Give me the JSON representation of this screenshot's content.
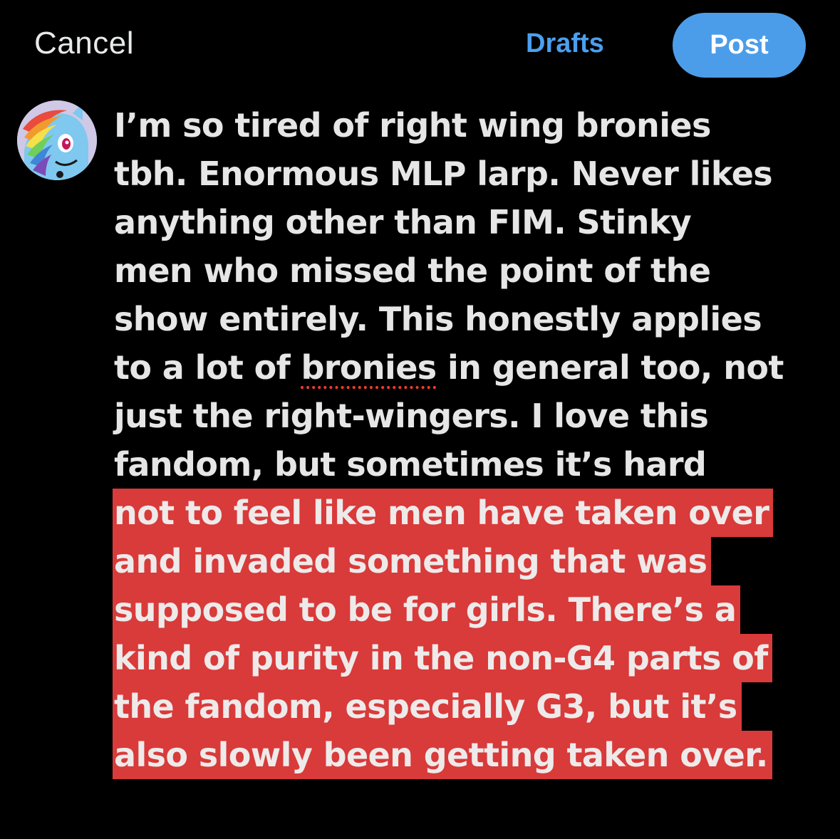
{
  "header": {
    "cancel_label": "Cancel",
    "drafts_label": "Drafts",
    "post_label": "Post"
  },
  "colors": {
    "background": "#000000",
    "accent": "#4c9de9",
    "highlight": "#d93a3a"
  },
  "composer": {
    "avatar_icon": "pony-avatar-icon",
    "lines": [
      "I’m so tired of right wing bronies",
      "tbh. Enormous MLP larp. Never likes",
      "anything other than FIM. Stinky",
      "men who missed the point of the",
      "show entirely. This honestly applies",
      "to a lot of ",
      "bronies",
      " in general too, not",
      "just the right-wingers. I love this",
      "fandom, but sometimes it’s hard"
    ],
    "highlighted_lines": [
      "not to feel like men have taken over",
      "and invaded something that was",
      "supposed to be for girls. There’s a",
      "kind of purity in the non-G4 parts of",
      "the fandom, especially G3, but it’s",
      "also slowly been getting taken over."
    ]
  }
}
